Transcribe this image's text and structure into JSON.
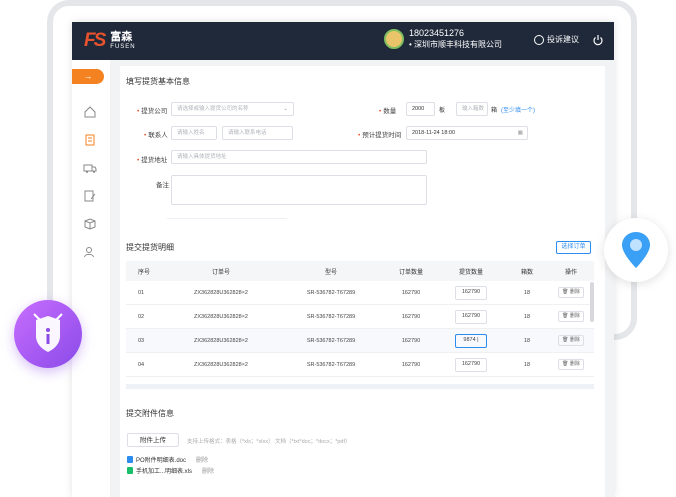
{
  "header": {
    "logo_mark": "FS",
    "logo_cn": "富森",
    "logo_en": "FUSEN",
    "user_phone": "18023451276",
    "user_company": "• 深圳市顺丰科技有限公司",
    "feedback_label": "投诉建议"
  },
  "sidebar": {
    "active_arrow": "→",
    "icons": [
      "home-icon",
      "clipboard-icon",
      "truck-icon",
      "edit-doc-icon",
      "box-icon",
      "user-settings-icon"
    ]
  },
  "basic_info": {
    "title": "填写提货基本信息",
    "company_label": "提货公司",
    "company_placeholder": "请选择或输入提货公司的名称",
    "quantity_label": "数量",
    "quantity_value": "2000",
    "quantity_unit": "板",
    "boxes_placeholder": "输入箱数",
    "boxes_unit": "箱",
    "boxes_hint": "(至少填一个)",
    "contact_label": "联系人",
    "contact_name_placeholder": "请输入姓名",
    "contact_phone_placeholder": "请输入联系电话",
    "time_label": "预计提货时间",
    "time_value": "2018-11-24  18:00",
    "address_label": "提货地址",
    "address_placeholder": "请输入具体提货地址",
    "remark_label": "备注"
  },
  "detail": {
    "title": "提交提货明细",
    "select_order_btn": "选择订单",
    "columns": [
      "序号",
      "订单号",
      "型号",
      "订单数量",
      "提货数量",
      "箱数",
      "操作"
    ],
    "rows": [
      {
        "no": "01",
        "order": "ZX362828U362828×2",
        "model": "SR-536782-T67289",
        "order_qty": "162790",
        "pick_qty": "162790",
        "boxes": "18",
        "action": "删除"
      },
      {
        "no": "02",
        "order": "ZX362828U362828×2",
        "model": "SR-536782-T67289",
        "order_qty": "162790",
        "pick_qty": "162790",
        "boxes": "18",
        "action": "删除"
      },
      {
        "no": "03",
        "order": "ZX362828U362828×2",
        "model": "SR-536782-T67289",
        "order_qty": "162790",
        "pick_qty": "9874 |",
        "boxes": "18",
        "action": "删除"
      },
      {
        "no": "04",
        "order": "ZX362828U362828×2",
        "model": "SR-536782-T67289",
        "order_qty": "162790",
        "pick_qty": "162790",
        "boxes": "18",
        "action": "删除"
      }
    ]
  },
  "attachments": {
    "title": "提交附件信息",
    "upload_btn": "附件上传",
    "hint": "支持上传格式：表格（*xls；*xlsx）  文档（*txt*doc；*docx；*pdf）",
    "files": [
      {
        "name": "PO附件明细表.doc",
        "action": "删除",
        "color": "#2d8cf0"
      },
      {
        "name": "手机加工...明细表.xls",
        "action": "删除",
        "color": "#19be6b"
      }
    ]
  },
  "colors": {
    "topbar": "#20293a",
    "accent": "#f58220",
    "link": "#2d8cf0",
    "badge": "#9b59f0"
  }
}
